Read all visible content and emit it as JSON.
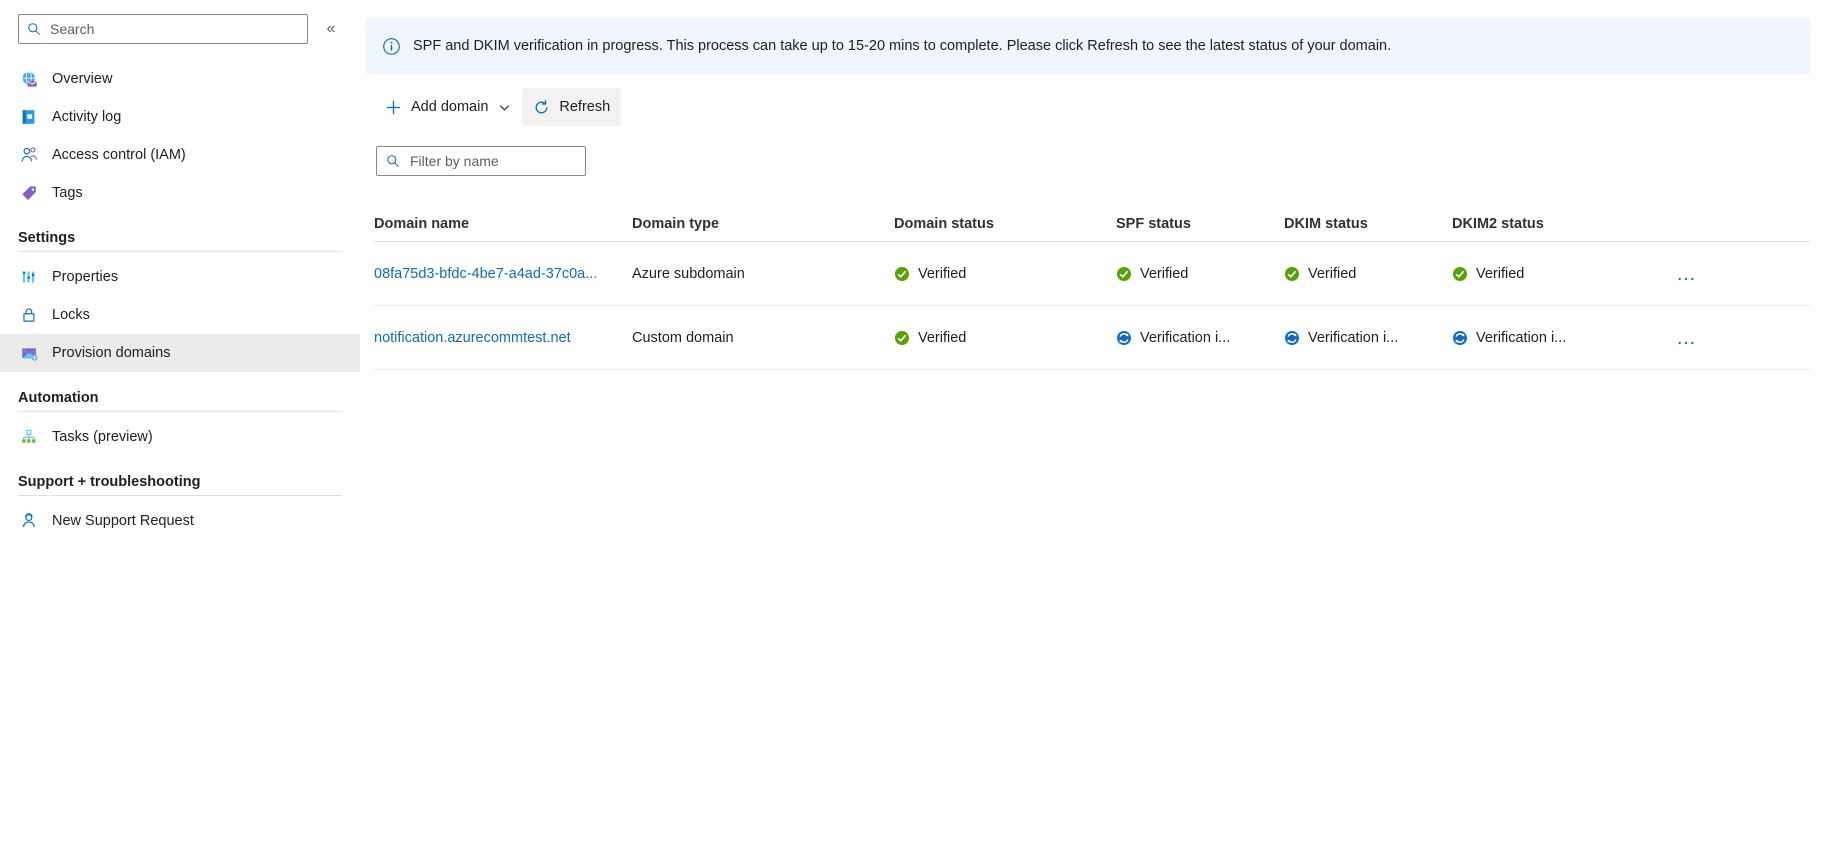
{
  "sidebar": {
    "search": {
      "placeholder": "Search",
      "value": "",
      "icon": "search-icon"
    },
    "collapse_label": "«",
    "items": [
      {
        "label": "Overview",
        "icon": "globe-mail-icon"
      },
      {
        "label": "Activity log",
        "icon": "activity-log-icon"
      },
      {
        "label": "Access control (IAM)",
        "icon": "people-icon"
      },
      {
        "label": "Tags",
        "icon": "tag-icon"
      }
    ],
    "groups": [
      {
        "title": "Settings",
        "items": [
          {
            "label": "Properties",
            "icon": "properties-icon",
            "selected": false
          },
          {
            "label": "Locks",
            "icon": "lock-icon",
            "selected": false
          },
          {
            "label": "Provision domains",
            "icon": "mail-domain-icon",
            "selected": true
          }
        ]
      },
      {
        "title": "Automation",
        "items": [
          {
            "label": "Tasks (preview)",
            "icon": "tasks-tree-icon",
            "selected": false
          }
        ]
      },
      {
        "title": "Support + troubleshooting",
        "items": [
          {
            "label": "New Support Request",
            "icon": "support-person-icon",
            "selected": false
          }
        ]
      }
    ]
  },
  "banner": {
    "icon": "info-circle-icon",
    "text": "SPF and DKIM verification in progress. This process can take up to 15-20 mins to complete. Please click Refresh to see the latest status of your domain.",
    "background": "#eff6fd"
  },
  "toolbar": {
    "add_domain_label": "Add domain",
    "add_domain_icon": "plus-icon",
    "add_domain_caret": "chevron-down-icon",
    "refresh_label": "Refresh",
    "refresh_icon": "refresh-icon"
  },
  "filter": {
    "placeholder": "Filter by name",
    "value": "",
    "icon": "search-icon"
  },
  "table": {
    "columns": [
      "Domain name",
      "Domain type",
      "Domain status",
      "SPF status",
      "DKIM status",
      "DKIM2 status"
    ],
    "more_label": "…",
    "rows": [
      {
        "domain_name": "08fa75d3-bfdc-4be7-a4ad-37c0a...",
        "domain_type": "Azure subdomain",
        "domain_status": {
          "text": "Verified",
          "icon": "check-circle-green-icon"
        },
        "spf_status": {
          "text": "Verified",
          "icon": "check-circle-green-icon"
        },
        "dkim_status": {
          "text": "Verified",
          "icon": "check-circle-green-icon"
        },
        "dkim2_status": {
          "text": "Verified",
          "icon": "check-circle-green-icon"
        }
      },
      {
        "domain_name": "notification.azurecommtest.net",
        "domain_type": "Custom domain",
        "domain_status": {
          "text": "Verified",
          "icon": "check-circle-green-icon"
        },
        "spf_status": {
          "text": "Verification i...",
          "icon": "sync-circle-blue-icon"
        },
        "dkim_status": {
          "text": "Verification i...",
          "icon": "sync-circle-blue-icon"
        },
        "dkim2_status": {
          "text": "Verification i...",
          "icon": "sync-circle-blue-icon"
        }
      }
    ]
  },
  "colors": {
    "link": "#0f6cbd",
    "success": "#57a300",
    "info": "#0f6cbd",
    "selected_row": "#edebe9"
  }
}
